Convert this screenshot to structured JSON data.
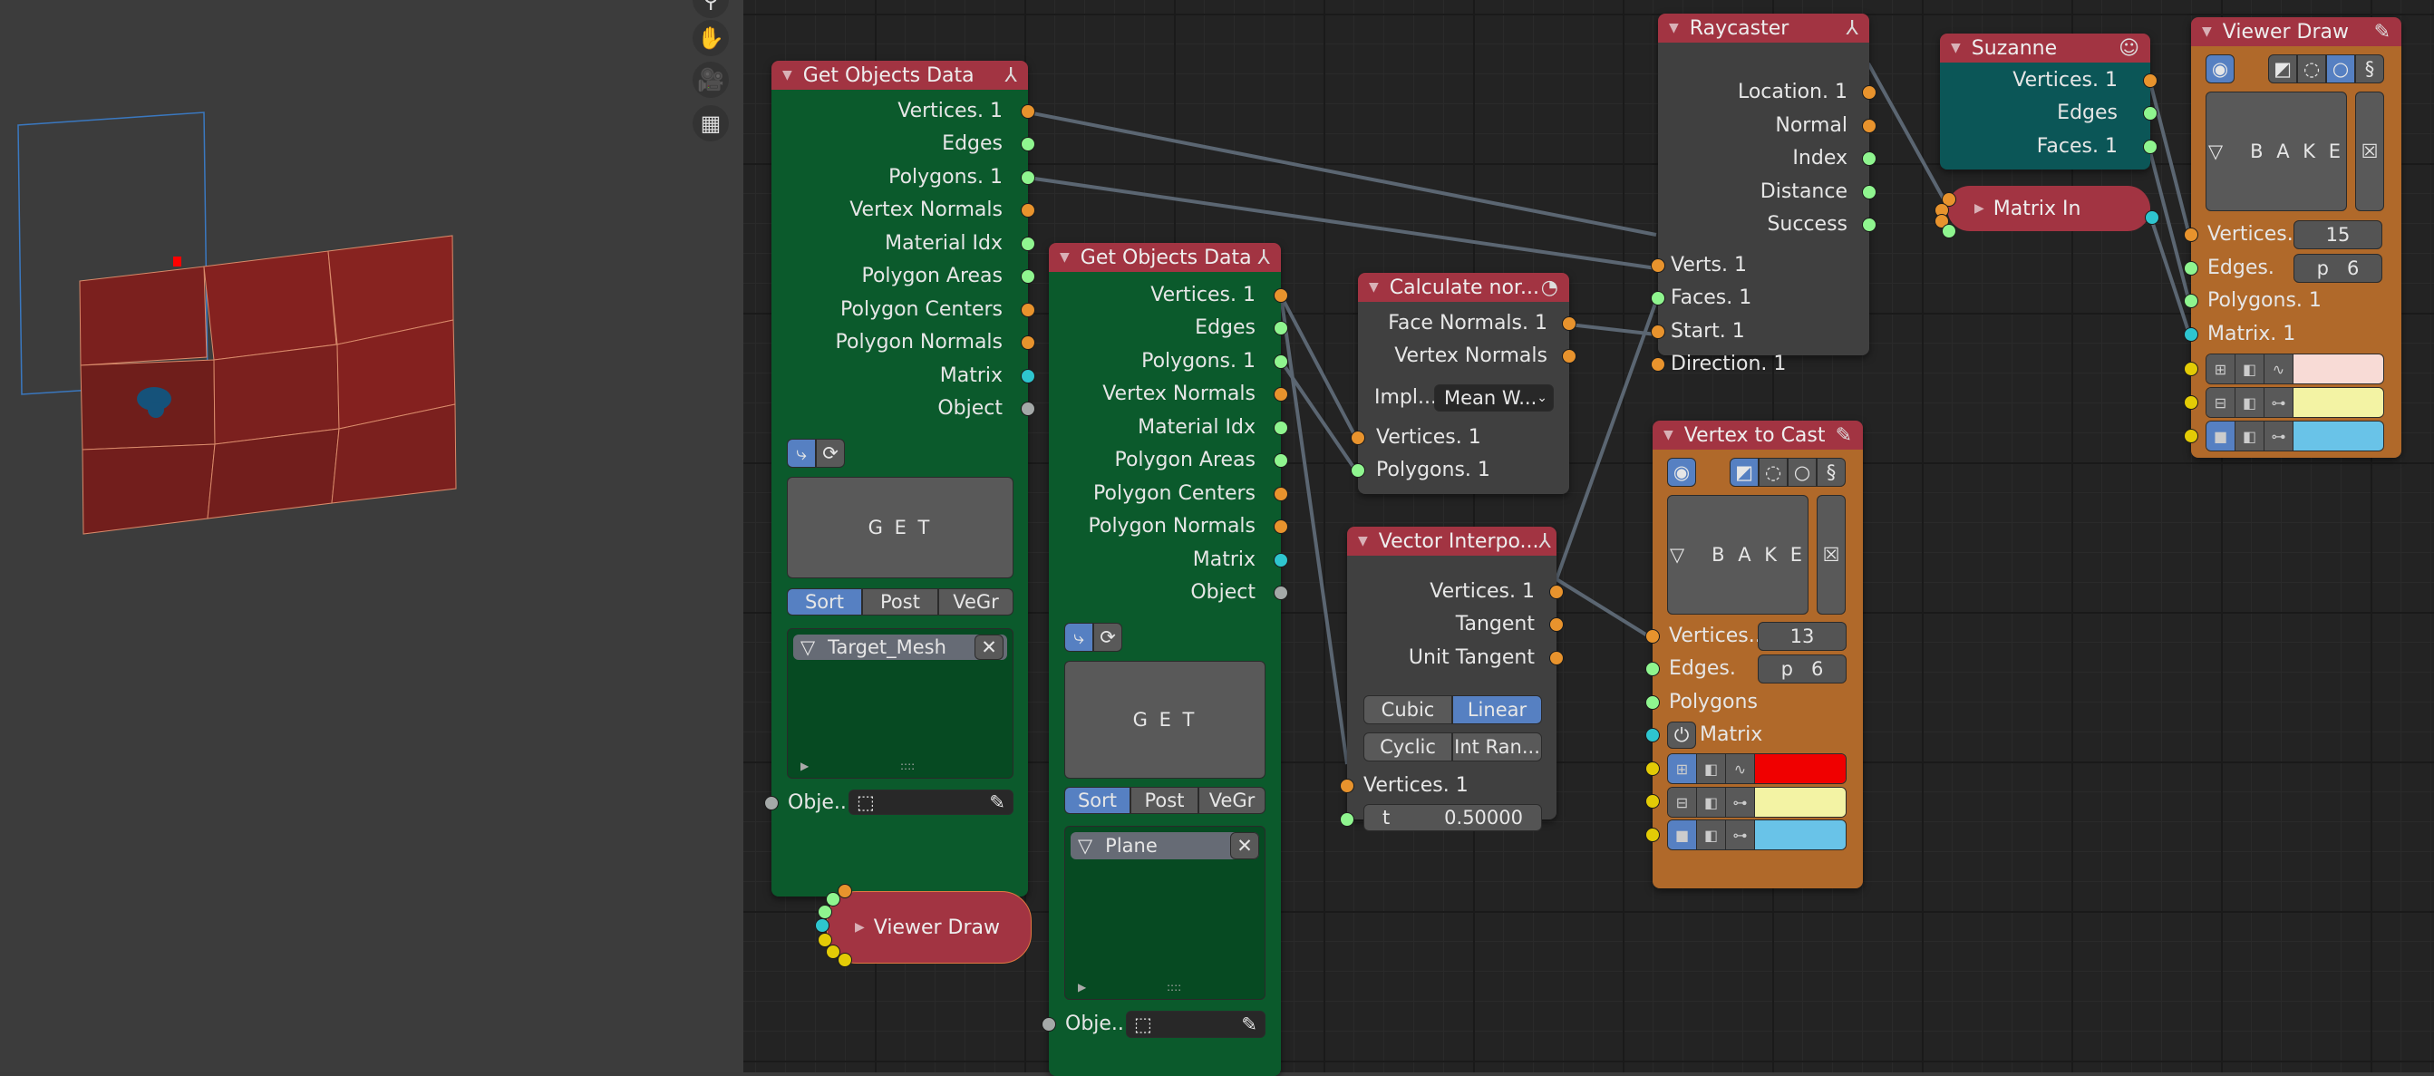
{
  "viewport": {
    "nav_icons": [
      "zoom-icon",
      "hand-pan-icon",
      "camera-icon",
      "grid-ortho-icon"
    ],
    "colors": {
      "plane_face": "#84211f",
      "camera_frame": "#3a78c0",
      "marker": "#ff0000",
      "suzanne": "#15527a"
    }
  },
  "nodes": {
    "god1": {
      "title": "Get Objects Data",
      "outputs": [
        "Vertices. 1",
        "Edges",
        "Polygons. 1",
        "Vertex Normals",
        "Material Idx",
        "Polygon Areas",
        "Polygon Centers",
        "Polygon Normals",
        "Matrix",
        "Object"
      ],
      "get_label": "G E T",
      "tabs": [
        "Sort",
        "Post",
        "VeGr"
      ],
      "active_tab": "Sort",
      "list_item": "Target_Mesh",
      "object_input_label": "Obje..."
    },
    "god2": {
      "title": "Get Objects Data",
      "outputs": [
        "Vertices. 1",
        "Edges",
        "Polygons. 1",
        "Vertex Normals",
        "Material Idx",
        "Polygon Areas",
        "Polygon Centers",
        "Polygon Normals",
        "Matrix",
        "Object"
      ],
      "get_label": "G E T",
      "tabs": [
        "Sort",
        "Post",
        "VeGr"
      ],
      "active_tab": "Sort",
      "list_item": "Plane",
      "object_input_label": "Obje..."
    },
    "calc": {
      "title": "Calculate nor...",
      "outputs": [
        "Face Normals. 1",
        "Vertex Normals"
      ],
      "impl_label": "Impl...",
      "impl_value": "Mean W...",
      "inputs": [
        "Vertices. 1",
        "Polygons. 1"
      ]
    },
    "vinterp": {
      "title": "Vector Interpo...",
      "outputs": [
        "Vertices. 1",
        "Tangent",
        "Unit Tangent"
      ],
      "mode_options": [
        "Cubic",
        "Linear"
      ],
      "mode_selected": "Linear",
      "options": [
        "Cyclic",
        "Int Ran..."
      ],
      "inputs": [
        "Vertices. 1"
      ],
      "t_label": "t",
      "t_value": "0.50000"
    },
    "raycaster": {
      "title": "Raycaster",
      "outputs": [
        "Location. 1",
        "Normal",
        "Index",
        "Distance",
        "Success"
      ],
      "inputs": [
        "Verts. 1",
        "Faces. 1",
        "Start. 1",
        "Direction. 1"
      ]
    },
    "suzanne": {
      "title": "Suzanne",
      "outputs": [
        "Vertices. 1",
        "Edges",
        "Faces. 1"
      ]
    },
    "matrix_in": {
      "title": "Matrix In"
    },
    "viewer_small": {
      "title": "Viewer Draw"
    },
    "vtc": {
      "title": "Vertex to Cast",
      "bake_label": "B A K E",
      "vertices_label": "Vertices...",
      "vertices_value": "13",
      "edges_label": "Edges.",
      "edges_value": "p   6",
      "polygons_label": "Polygons",
      "matrix_label": "Matrix",
      "colors": [
        "#f00000",
        "#f3f3a4",
        "#69c3e8"
      ]
    },
    "viewer": {
      "title": "Viewer Draw",
      "bake_label": "B A K E",
      "vertices_label": "Vertices...",
      "vertices_value": "15",
      "edges_label": "Edges.",
      "edges_value": "p   6",
      "polygons_label": "Polygons. 1",
      "matrix_label": "Matrix. 1",
      "colors": [
        "#f8dbd6",
        "#f3f3a4",
        "#69c3e8"
      ]
    }
  }
}
